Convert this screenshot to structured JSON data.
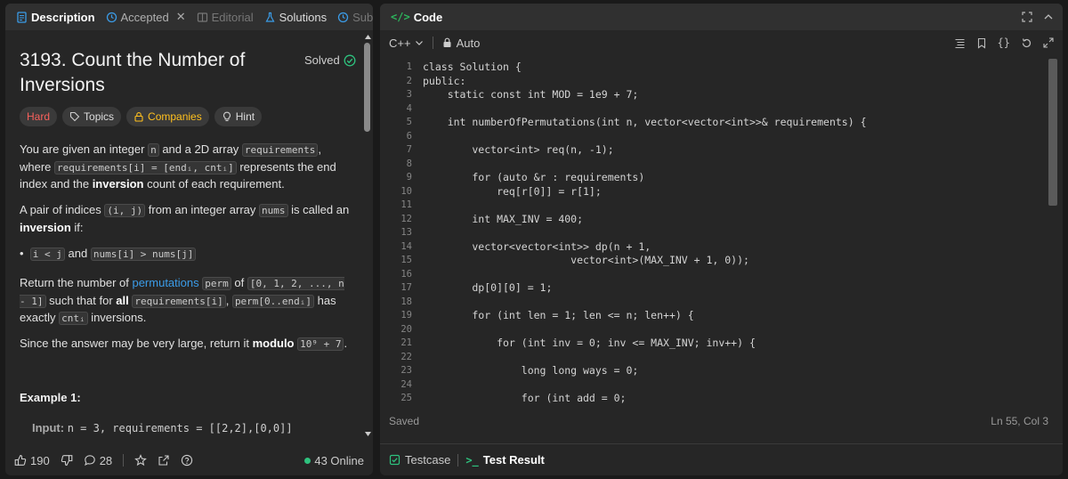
{
  "left_tabs": {
    "description": "Description",
    "accepted": "Accepted",
    "editorial": "Editorial",
    "solutions": "Solutions",
    "submissions": "Sub"
  },
  "problem": {
    "title": "3193. Count the Number of Inversions",
    "status": "Solved",
    "difficulty": "Hard",
    "tags": [
      "Topics",
      "Companies",
      "Hint"
    ],
    "p1_a": "You are given an integer ",
    "p1_n": "n",
    "p1_b": " and a 2D array ",
    "p1_req": "requirements",
    "p1_c": ", where ",
    "p1_code": "requirements[i] = [endᵢ, cntᵢ]",
    "p1_d": " represents the end index and the ",
    "p1_bold": "inversion",
    "p1_e": " count of each requirement.",
    "p2_a": "A pair of indices ",
    "p2_code": "(i, j)",
    "p2_b": " from an integer array ",
    "p2_nums": "nums",
    "p2_c": " is called an ",
    "p2_bold": "inversion",
    "p2_d": " if:",
    "bullet_code1": "i < j",
    "bullet_and": " and ",
    "bullet_code2": "nums[i] > nums[j]",
    "p3_a": "Return the number of ",
    "p3_link": "permutations",
    "p3_perm": "perm",
    "p3_of": " of ",
    "p3_range": "[0, 1, 2, ..., n - 1]",
    "p3_b": " such that for ",
    "p3_all": "all",
    "p3_req": "requirements[i]",
    "p3_comma": ", ",
    "p3_permrange": "perm[0..endᵢ]",
    "p3_c": " has exactly ",
    "p3_cnt": "cntᵢ",
    "p3_d": " inversions.",
    "p4_a": "Since the answer may be very large, return it ",
    "p4_bold": "modulo",
    "p4_code": "10⁹ + 7",
    "p4_b": ".",
    "example_title": "Example 1:",
    "input_label": "Input:",
    "input_value": "n = 3, requirements = [[2,2],[0,0]]"
  },
  "left_footer": {
    "likes": "190",
    "comments": "28",
    "online": "43 Online"
  },
  "code_panel": {
    "title": "Code",
    "language": "C++",
    "mode": "Auto",
    "saved": "Saved",
    "cursor": "Ln 55, Col 3",
    "testcase": "Testcase",
    "test_result": "Test Result"
  },
  "line_numbers": [
    "1",
    "2",
    "3",
    "4",
    "5",
    "6",
    "7",
    "8",
    "9",
    "10",
    "11",
    "12",
    "13",
    "14",
    "15",
    "16",
    "17",
    "18",
    "19",
    "20",
    "21",
    "22",
    "23",
    "24",
    "25"
  ],
  "code_lines": [
    "class Solution {",
    "public:",
    "    static const int MOD = 1e9 + 7;",
    "",
    "    int numberOfPermutations(int n, vector<vector<int>>& requirements) {",
    "",
    "        vector<int> req(n, -1);",
    "",
    "        for (auto &r : requirements)",
    "            req[r[0]] = r[1];",
    "",
    "        int MAX_INV = 400;",
    "",
    "        vector<vector<int>> dp(n + 1,",
    "                        vector<int>(MAX_INV + 1, 0));",
    "",
    "        dp[0][0] = 1;",
    "",
    "        for (int len = 1; len <= n; len++) {",
    "",
    "            for (int inv = 0; inv <= MAX_INV; inv++) {",
    "",
    "                long long ways = 0;",
    "",
    "                for (int add = 0;"
  ],
  "colors": {
    "hard": "#f8615c",
    "companies": "#ffc01e",
    "link": "#3b9ce8",
    "online": "#2ec27e",
    "code_icon": "#2db55d"
  }
}
